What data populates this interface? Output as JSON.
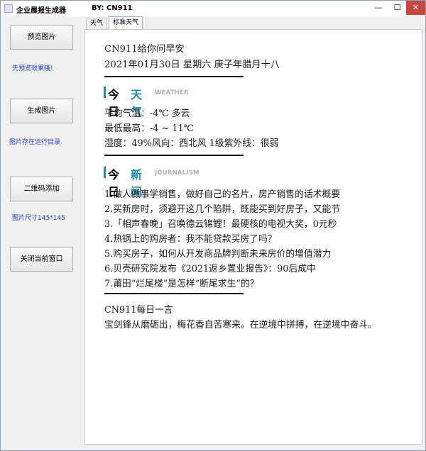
{
  "window": {
    "title": "企业晨报生成器",
    "by": "BY:  CN911",
    "controls": {
      "minimize": "—",
      "maximize": "☐",
      "close": "✕"
    }
  },
  "sidebar": {
    "preview_button": "预览图片",
    "preview_hint": "先预览效果哦!",
    "generate_button": "生成图片",
    "generate_hint": "图片存在运行目录",
    "qrcode_button": "二维码添加",
    "qrcode_hint": "图片尺寸145*145",
    "close_button": "关闭当前窗口"
  },
  "tabs": [
    "天气",
    "标准天气"
  ],
  "report": {
    "greeting": "CN911给你问早安",
    "date_line": "2021年01月30日   星期六   庚子年腊月十八",
    "weather_section": {
      "title_a": "今日",
      "title_b": "天气",
      "title_en": "WEATHER"
    },
    "weather": {
      "avg_temp": "平均气温：-4℃  多云",
      "range": "最低最高：-4  ~  11℃",
      "humidity": "湿度：49%风向：西北风  1级紫外线：很弱"
    },
    "news_section": {
      "title_a": "今日",
      "title_b": "新闻",
      "title_en": "JOURNALISM"
    },
    "news": [
      "1.做人做事学销售，做好自己的名片，房产销售的话术概要",
      "2.买新房时，须避开这几个陷阱，既能买到好房子，又能节",
      "3.「相声春晚」召唤德云锦鲤！最硬核的电视大奖，0元秒",
      "4.热锅上的购房者：我不能贷款买房了吗？",
      "5.购买房子，如何从开发商品牌判断未来房价的增值潜力",
      "6.贝壳研究院发布《2021返乡置业报告》：90后成中",
      "7.莆田“烂尾楼”是怎样“断尾求生”的？"
    ],
    "quote_title": "CN911每日一言",
    "quote": "宝剑锋从磨砺出，梅花香自苦寒来。在逆境中拼搏，在逆境中奋斗。"
  },
  "colors": {
    "accent": "#1d8cab",
    "hint_text": "#1b3cc8",
    "close_button": "#c7463d"
  }
}
